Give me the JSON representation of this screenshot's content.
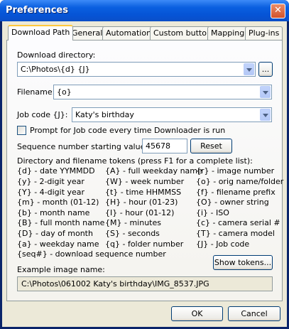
{
  "window": {
    "title": "Preferences",
    "close_glyph": "✕"
  },
  "tabs": [
    {
      "label": "Download Path",
      "active": true
    },
    {
      "label": "General"
    },
    {
      "label": "Automation"
    },
    {
      "label": "Custom button"
    },
    {
      "label": "Mapping"
    },
    {
      "label": "Plug-ins"
    }
  ],
  "download_directory": {
    "label": "Download directory:",
    "value": "C:\\Photos\\{d} {J}",
    "browse_label": "..."
  },
  "filename": {
    "label": "Filename:",
    "value": "{o}"
  },
  "job_code": {
    "label": "Job code {J}:",
    "value": "Katy's birthday"
  },
  "prompt_checkbox": {
    "label": "Prompt for Job code every time Downloader is run",
    "checked": false
  },
  "sequence": {
    "label": "Sequence number starting value:",
    "value": "45678",
    "reset_label": "Reset"
  },
  "tokens": {
    "heading": "Directory and filename tokens (press F1 for a complete list):",
    "col1": [
      "{d} - date YYMMDD",
      "{y} - 2-digit year",
      "{Y} - 4-digit year",
      "{m} - month (01-12)",
      "{b} - month name",
      "{B} - full month name",
      "{D} - day of month",
      "{a} - weekday name",
      "{seq#} - download sequence number"
    ],
    "col2": [
      "{A} - full weekday name",
      "{W} - week number",
      "{t} - time HHMMSS",
      "{H} - hour (01-23)",
      "{I} - hour (01-12)",
      "{M} - minutes",
      "{S} - seconds",
      "{q} - folder number"
    ],
    "col3": [
      "{r} - image number",
      "{o} - orig name/folder",
      "{f} - filename prefix",
      "{O} - owner string",
      "{i} - ISO",
      "{c} - camera serial #",
      "{T} - camera model",
      "{J} - Job code"
    ],
    "show_tokens_label": "Show tokens..."
  },
  "example": {
    "label": "Example image name:",
    "value": "C:\\Photos\\061002 Katy's birthday\\IMG_8537.JPG"
  },
  "buttons": {
    "ok": "OK",
    "cancel": "Cancel"
  }
}
